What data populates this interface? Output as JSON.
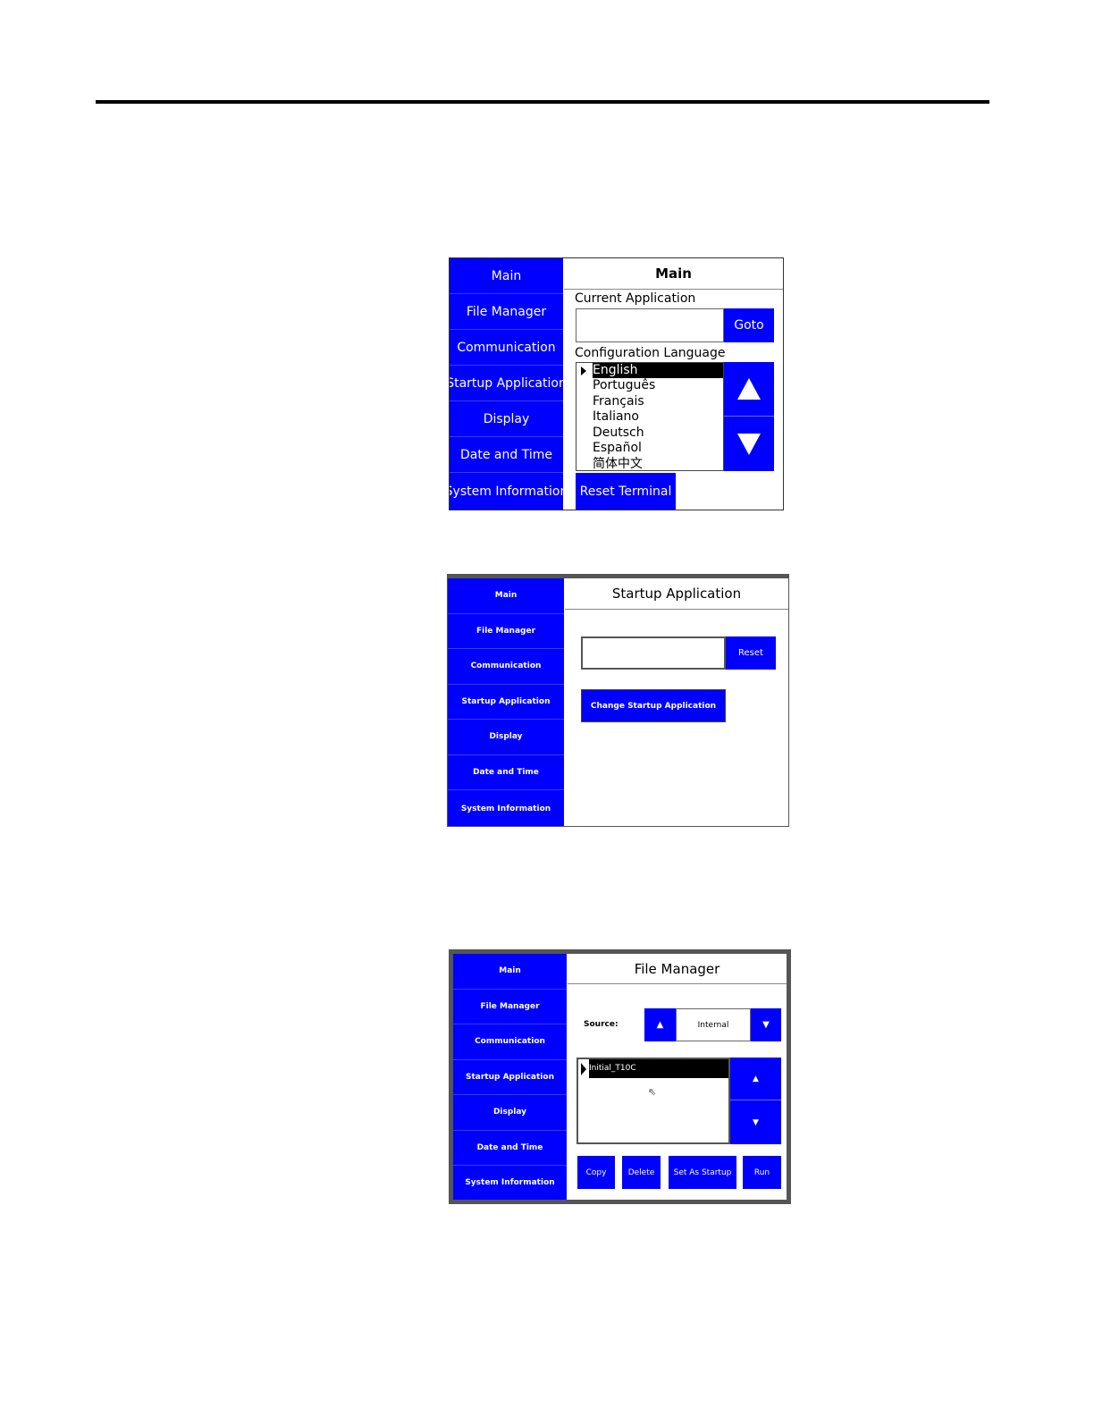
{
  "nav": [
    "Main",
    "File Manager",
    "Communication",
    "Startup Application",
    "Display",
    "Date and Time",
    "System Information"
  ],
  "screen_main": {
    "title": "Main",
    "current_app_label": "Current Application",
    "goto_label": "Goto",
    "config_lang_label": "Configuration Language",
    "languages": [
      "English",
      "Português",
      "Français",
      "Italiano",
      "Deutsch",
      "Español",
      "简体中文"
    ],
    "selected_language": "English",
    "up_icon": "triangle-up-icon",
    "down_icon": "triangle-down-icon",
    "reset_label": "Reset Terminal"
  },
  "screen_startup": {
    "title": "Startup Application",
    "reset_label": "Reset",
    "change_label": "Change Startup Application"
  },
  "screen_files": {
    "title": "File Manager",
    "source_label": "Source:",
    "source_value": "Internal",
    "files": [
      "Initial_T10C"
    ],
    "buttons": [
      "Copy",
      "Delete",
      "Set As Startup",
      "Run"
    ]
  },
  "colors": {
    "accent": "#0000ff",
    "selection": "#000000"
  }
}
